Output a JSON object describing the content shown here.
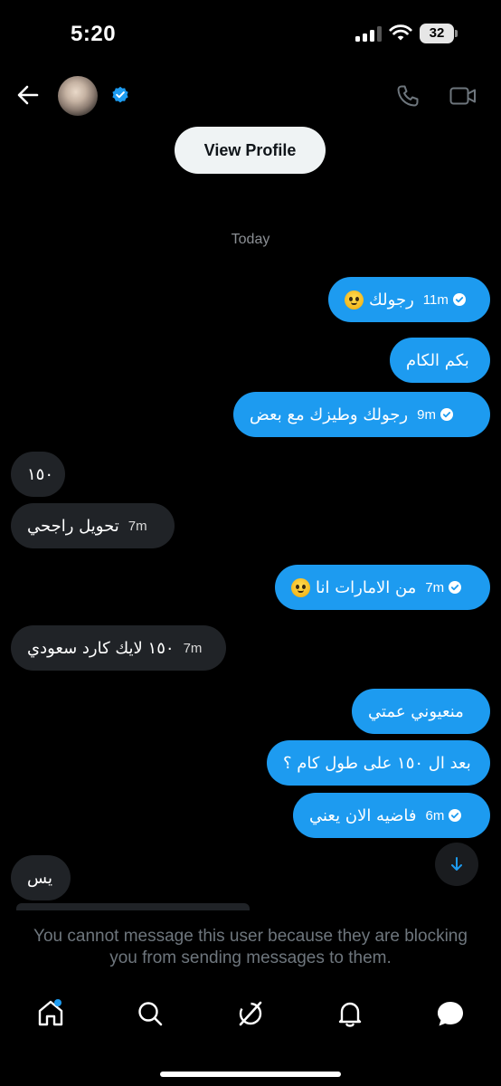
{
  "status_bar": {
    "time": "5:20",
    "battery": "32"
  },
  "header": {
    "view_profile_label": "View Profile"
  },
  "chat": {
    "date_separator": "Today",
    "messages": [
      {
        "direction": "out",
        "text": "رجولك",
        "emoji": "pleading-face-emoji",
        "time": "11m",
        "read": true
      },
      {
        "direction": "out",
        "text": "بكم الكام",
        "time": "",
        "read": false
      },
      {
        "direction": "out",
        "text": "رجولك وطيزك مع بعض",
        "time": "9m",
        "read": true
      },
      {
        "direction": "in",
        "text": "١٥٠",
        "time": ""
      },
      {
        "direction": "in",
        "text": "تحويل راجحي",
        "time": "7m"
      },
      {
        "direction": "out",
        "text": "من الامارات انا",
        "emoji": "crying-face-emoji",
        "time": "7m",
        "read": true
      },
      {
        "direction": "in",
        "text": "١٥٠ لايك كارد سعودي",
        "time": "7m"
      },
      {
        "direction": "out",
        "text": "منعيوني عمتي",
        "time": "",
        "read": false
      },
      {
        "direction": "out",
        "text": "بعد ال ١٥٠ على طول كام ؟",
        "time": "",
        "read": false
      },
      {
        "direction": "out",
        "text": "فاضيه الان يعني",
        "time": "6m",
        "read": true
      },
      {
        "direction": "in",
        "text": "يس",
        "time": ""
      }
    ]
  },
  "blocked_notice": "You cannot message this user because they are blocking you from sending messages to them.",
  "tabs": [
    "home-tab",
    "search-tab",
    "grok-tab",
    "notifications-tab",
    "messages-tab"
  ],
  "colors": {
    "accent": "#1d9bf0",
    "incoming_bubble": "#202327",
    "background": "#000000",
    "muted_text": "#6e767d"
  }
}
